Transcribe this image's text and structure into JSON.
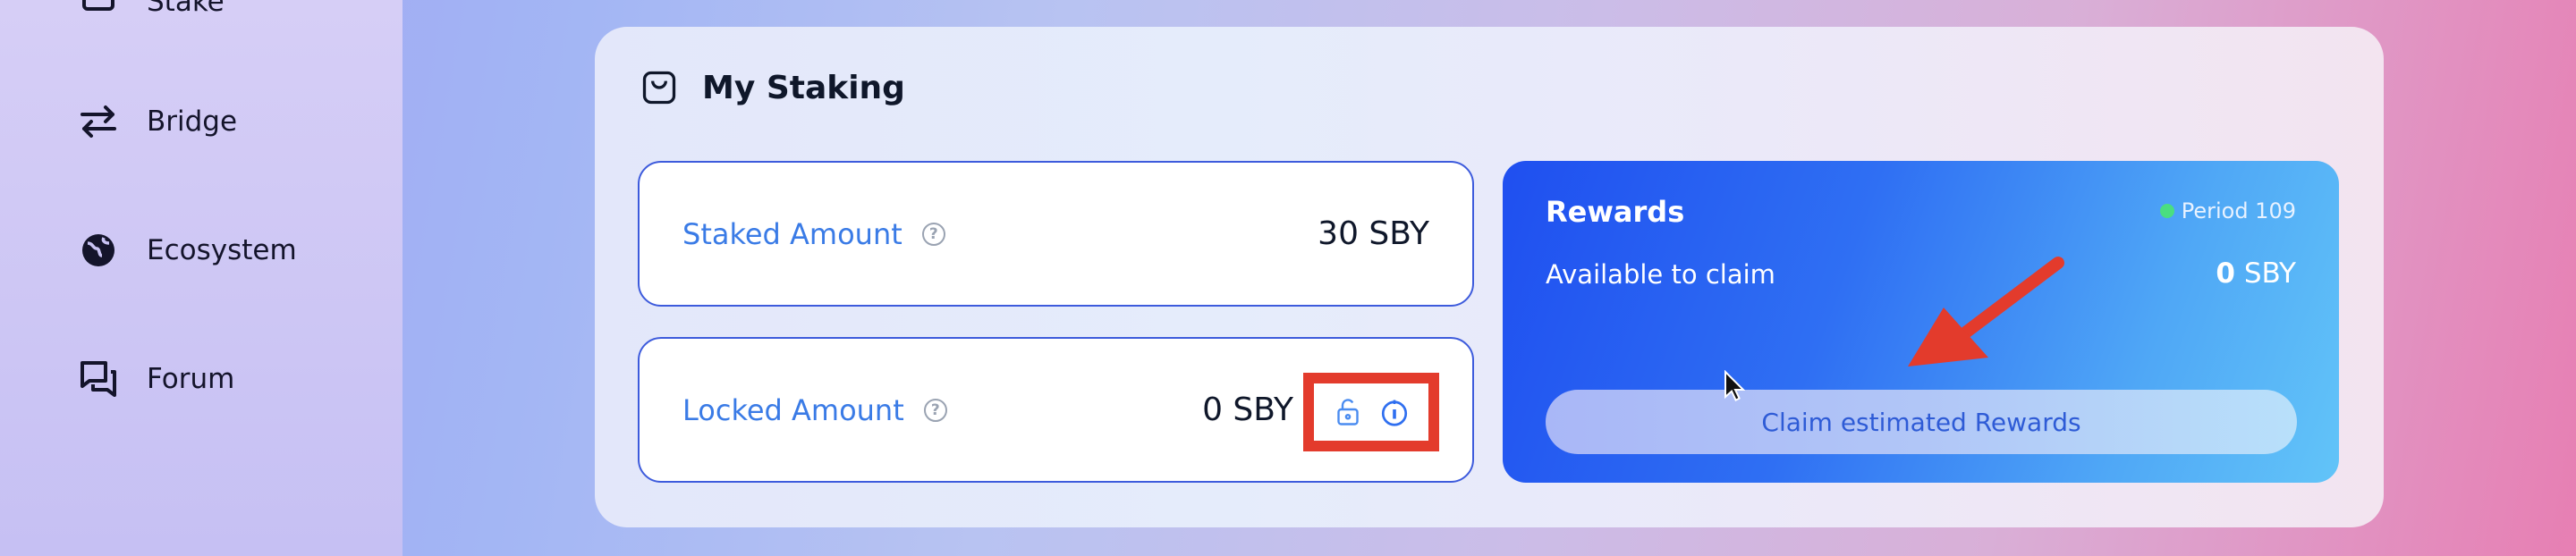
{
  "sidebar": {
    "items": [
      {
        "label": "Stake",
        "icon": "stake-icon"
      },
      {
        "label": "Bridge",
        "icon": "bridge-icon"
      },
      {
        "label": "Ecosystem",
        "icon": "globe-icon"
      },
      {
        "label": "Forum",
        "icon": "chat-icon"
      }
    ]
  },
  "staking": {
    "title": "My Staking",
    "title_icon": "bag-icon",
    "staked_label": "Staked Amount",
    "staked_value": "30 SBY",
    "locked_label": "Locked Amount",
    "locked_value": "0 SBY",
    "help_glyph": "?",
    "lock_actions": [
      "unlock-icon",
      "info-icon"
    ]
  },
  "rewards": {
    "title": "Rewards",
    "period": "Period 109",
    "available_label": "Available to claim",
    "amount_value": "0",
    "amount_unit": "SBY",
    "claim_label": "Claim estimated Rewards"
  },
  "colors": {
    "accent_blue": "#3a7be6",
    "highlight_red": "#e33b2c",
    "period_dot": "#4ade80"
  }
}
